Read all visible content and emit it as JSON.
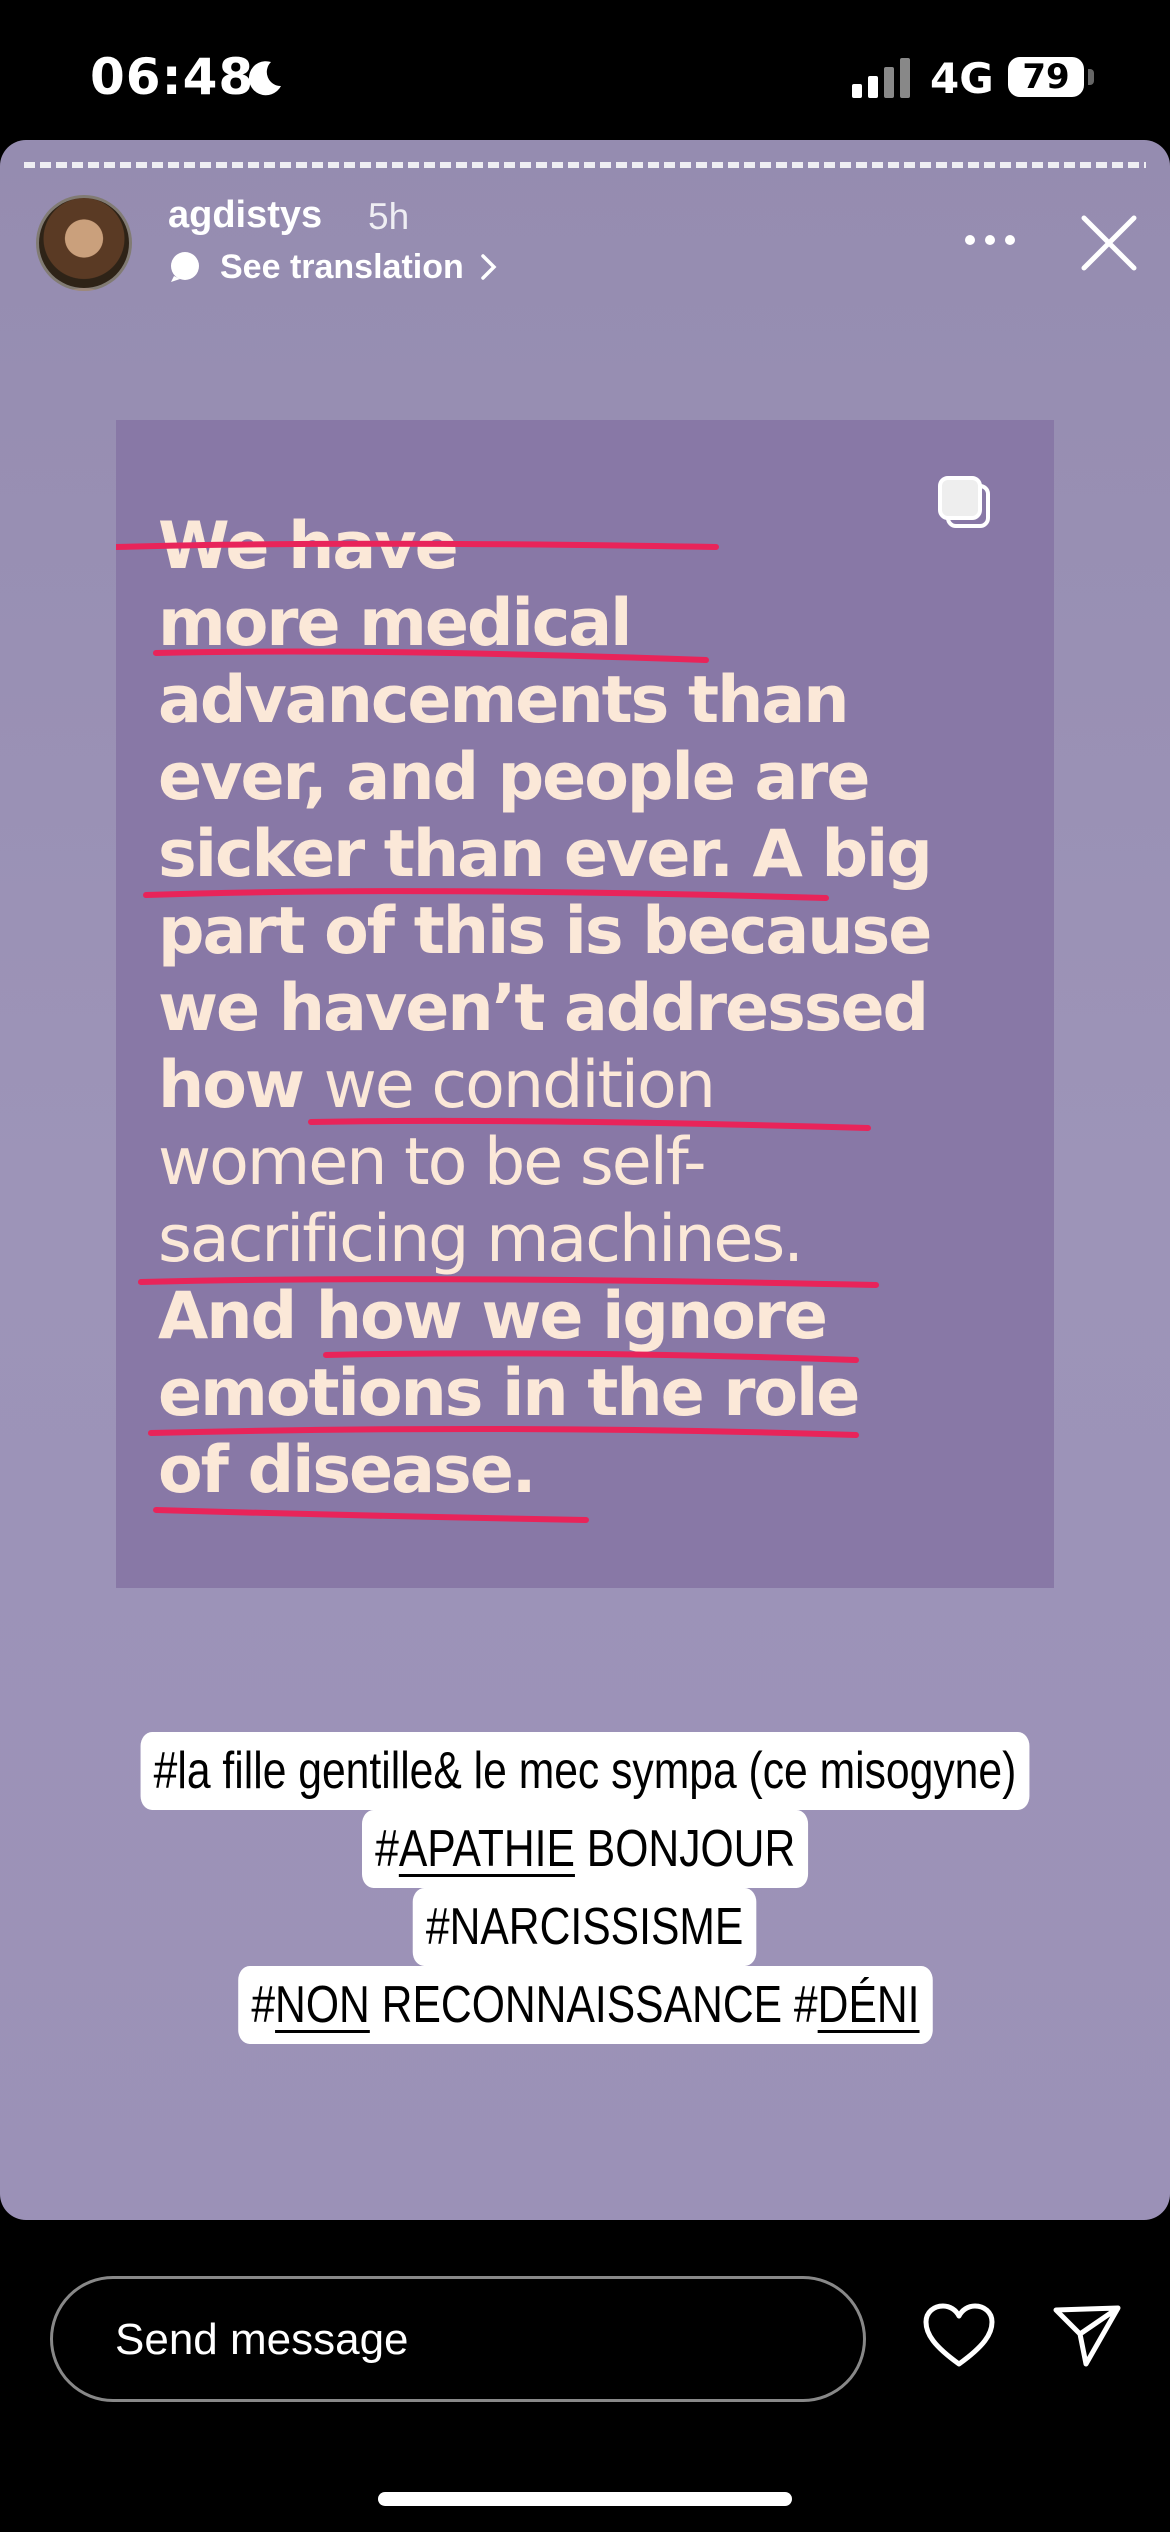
{
  "status_bar": {
    "time": "06:48",
    "network": "4G",
    "battery": "79"
  },
  "story": {
    "username": "agdistys",
    "time_ago": "5h",
    "translate_label": "See translation",
    "quote": {
      "line1": "We have",
      "line2": "more medical",
      "line3": "advancements than",
      "line4": "ever, and people are",
      "line5": "sicker than ever. A big",
      "line6": "part of this is because",
      "line7": "we haven’t addressed",
      "line8a": "how ",
      "line8b": "we condition",
      "line9": "women to be self-",
      "line10": "sacrificing machines.",
      "line11": "And how we ignore",
      "line12": "emotions in the role",
      "line13": "of disease."
    },
    "hashtags": {
      "tag1": "#la fille gentille& le mec sympa (ce misogyne)",
      "tag2_hash": "#",
      "tag2_u": "APATHIE",
      "tag2_rest": " BONJOUR",
      "tag3": "#NARCISSISME",
      "tag4_hash1": "#",
      "tag4_u1": "NON",
      "tag4_mid": " RECONNAISSANCE #",
      "tag4_u2": "DÉNI"
    },
    "accent_color": "#e8245a",
    "panel_color": "#8878a6"
  },
  "bottom_bar": {
    "message_placeholder": "Send message"
  }
}
